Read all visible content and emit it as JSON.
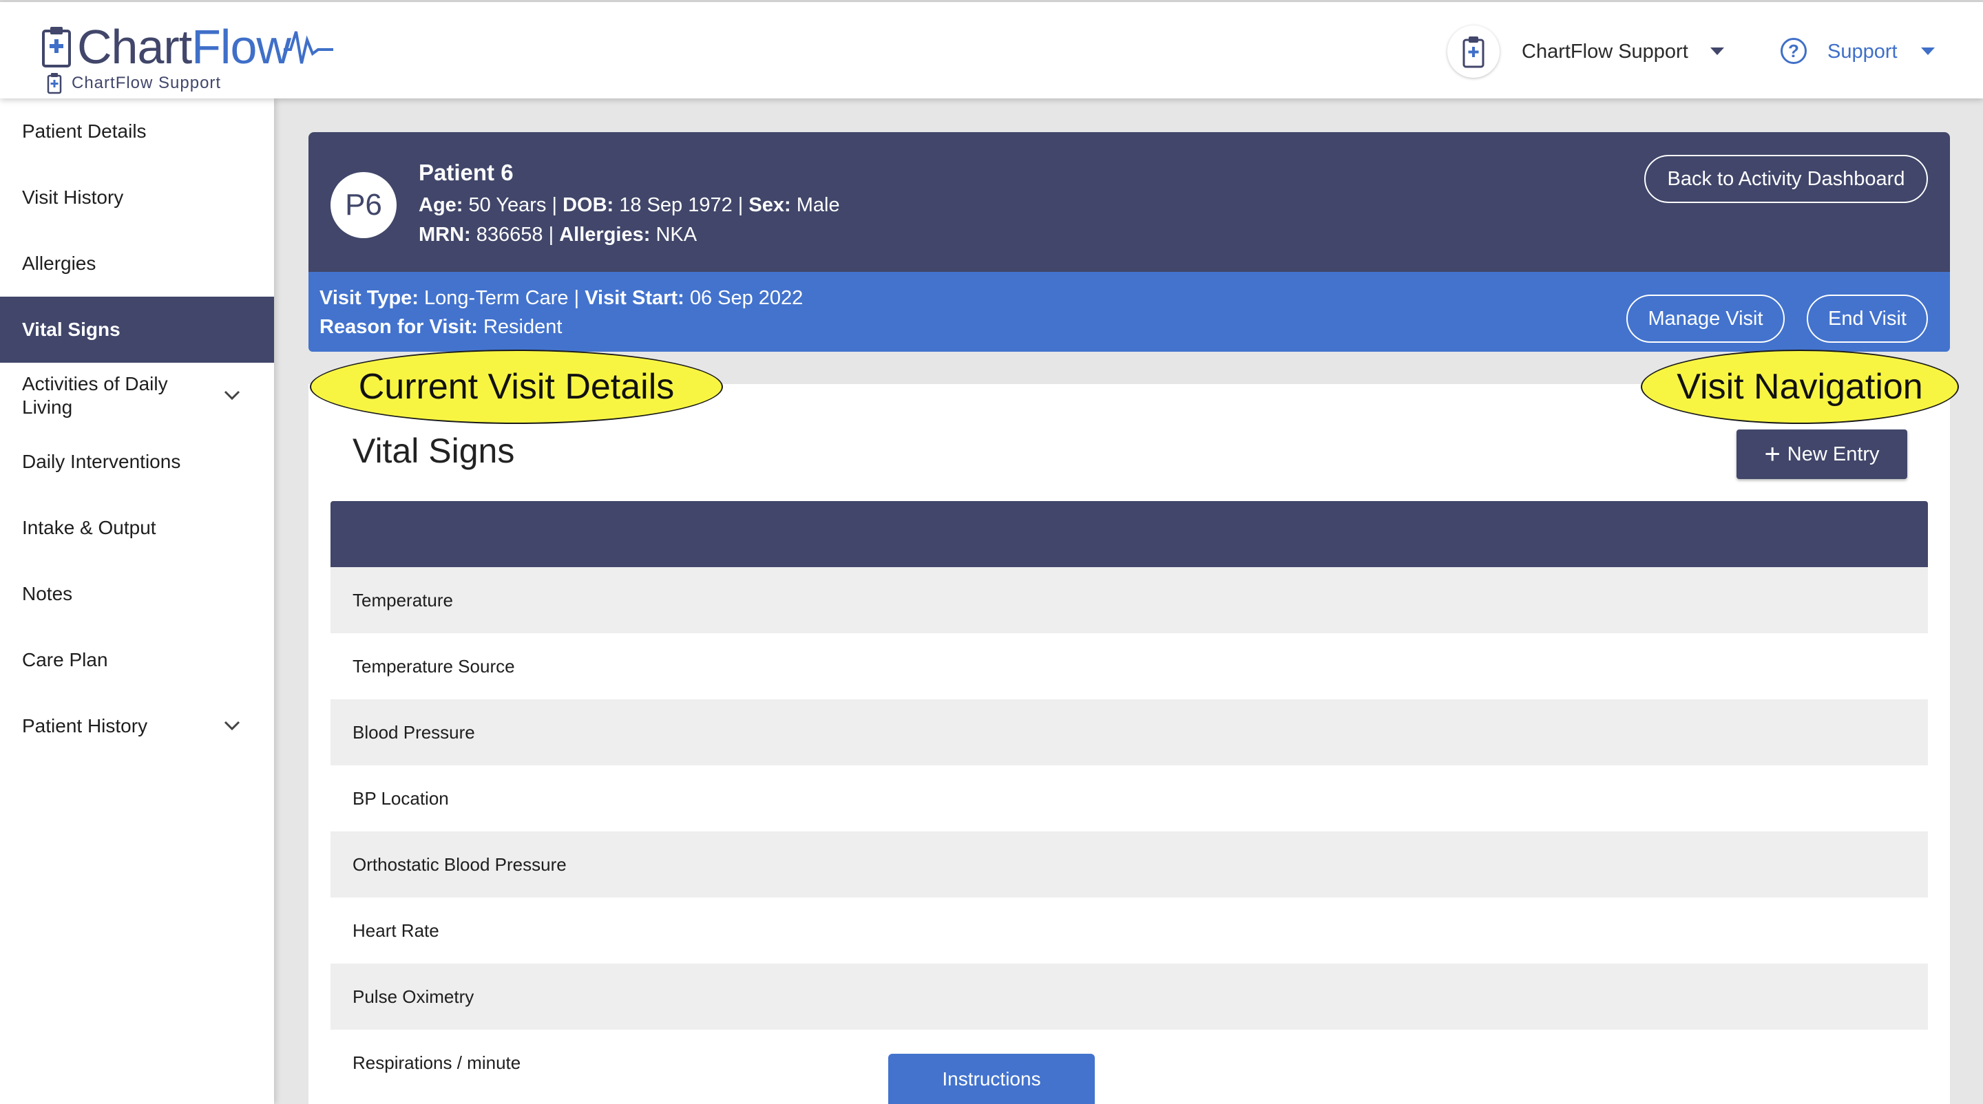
{
  "brand": {
    "logo_chart": "Chart",
    "logo_flow": "Flow",
    "subtitle": "ChartFlow Support",
    "accent": "#3f6fc8",
    "navy": "#41466a"
  },
  "header": {
    "user_name": "ChartFlow Support",
    "support_label": "Support",
    "help_glyph": "?"
  },
  "sidebar": {
    "items": [
      {
        "label": "Patient Details"
      },
      {
        "label": "Visit History"
      },
      {
        "label": "Allergies"
      },
      {
        "label": "Vital Signs",
        "active": true
      },
      {
        "label": "Activities of Daily Living",
        "expandable": true
      },
      {
        "label": "Daily Interventions"
      },
      {
        "label": "Intake & Output"
      },
      {
        "label": "Notes"
      },
      {
        "label": "Care Plan"
      },
      {
        "label": "Patient History",
        "expandable": true
      }
    ]
  },
  "patient": {
    "initials": "P6",
    "name": "Patient 6",
    "age_label": "Age:",
    "age_value": "50 Years",
    "dob_label": "DOB:",
    "dob_value": "18 Sep 1972",
    "sex_label": "Sex:",
    "sex_value": "Male",
    "mrn_label": "MRN:",
    "mrn_value": "836658",
    "allergies_label": "Allergies:",
    "allergies_value": "NKA",
    "sep": "|",
    "back_button": "Back to Activity Dashboard"
  },
  "visit": {
    "type_label": "Visit Type:",
    "type_value": "Long-Term Care",
    "start_label": "Visit Start:",
    "start_value": "06 Sep 2022",
    "reason_label": "Reason for Visit:",
    "reason_value": "Resident",
    "manage_button": "Manage Visit",
    "end_button": "End Visit"
  },
  "callouts": {
    "left": "Current Visit Details",
    "right": "Visit Navigation"
  },
  "panel": {
    "title": "Vital Signs",
    "new_entry_plus": "+",
    "new_entry_label": "New Entry",
    "rows": [
      "Temperature",
      "Temperature Source",
      "Blood Pressure",
      "BP Location",
      "Orthostatic Blood Pressure",
      "Heart Rate",
      "Pulse Oximetry",
      "Respirations / minute"
    ]
  },
  "instructions_label": "Instructions",
  "icons": {
    "logo": "clipboard-icon",
    "avatar": "clipboard-icon",
    "help": "help-circle-icon",
    "caret": "caret-down-icon",
    "chevron": "chevron-down-icon",
    "plus": "plus-icon"
  }
}
